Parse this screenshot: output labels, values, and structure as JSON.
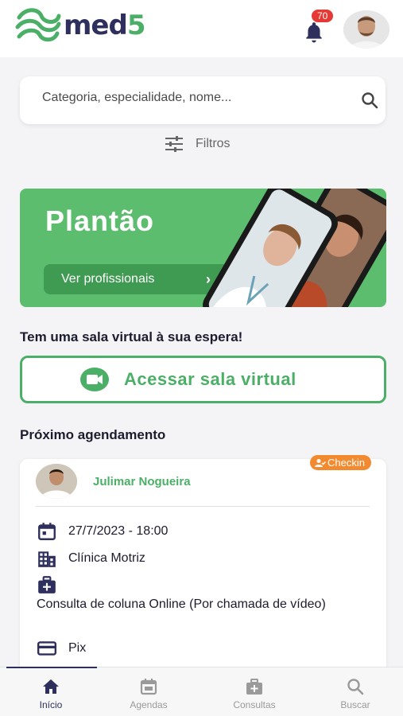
{
  "app": {
    "logo_text": "med",
    "logo_number": "5"
  },
  "header": {
    "notification_count": "70"
  },
  "search": {
    "placeholder": "Categoria, especialidade, nome..."
  },
  "filters": {
    "label": "Filtros"
  },
  "banner": {
    "title": "Plantão",
    "button_label": "Ver profissionais"
  },
  "virtual_room": {
    "heading": "Tem uma sala virtual à sua espera!",
    "button_label": "Acessar sala virtual"
  },
  "next_appointment": {
    "heading": "Próximo agendamento",
    "status_badge": "Checkin",
    "doctor_name": "Julimar Nogueira",
    "datetime": "27/7/2023 - 18:00",
    "clinic": "Clínica Motriz",
    "service": "Consulta de coluna Online (Por chamada de vídeo)",
    "payment": "Pix"
  },
  "bottom_nav": {
    "items": [
      {
        "label": "Início",
        "icon": "home-icon"
      },
      {
        "label": "Agendas",
        "icon": "calendar-icon"
      },
      {
        "label": "Consultas",
        "icon": "medical-bag-icon"
      },
      {
        "label": "Buscar",
        "icon": "search-icon"
      }
    ]
  },
  "colors": {
    "brand_green": "#4caf67",
    "brand_navy": "#2f2f5e",
    "badge_red": "#e53935",
    "checkin_orange": "#f28b30"
  }
}
